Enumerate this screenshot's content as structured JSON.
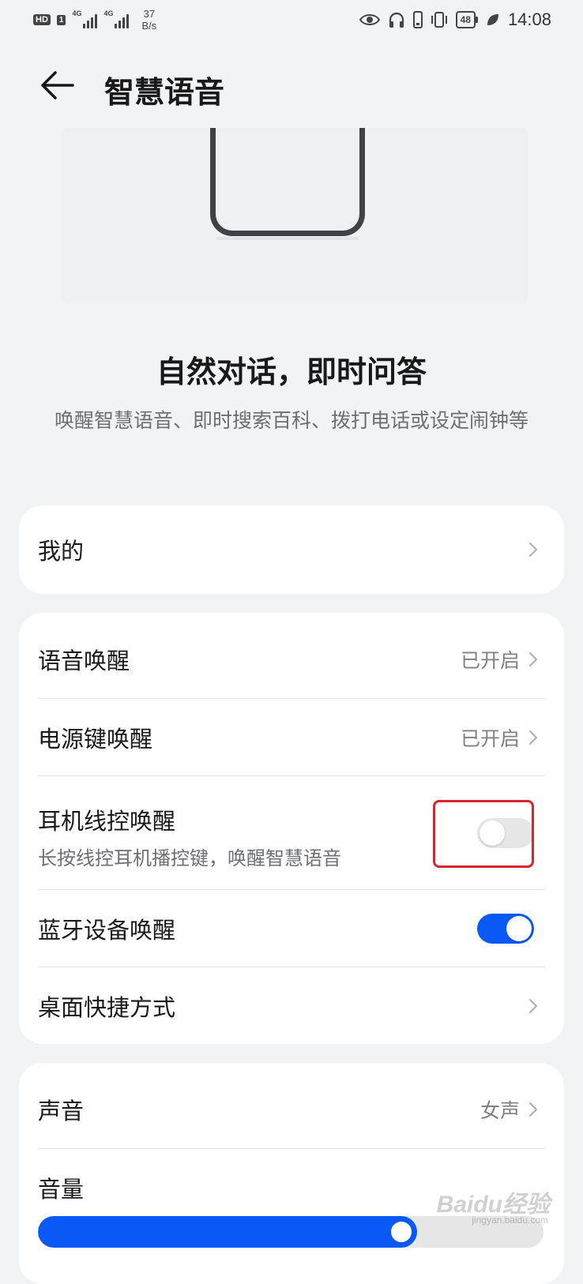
{
  "status_bar": {
    "hd": "HD",
    "sim": "1",
    "net1": "4G",
    "net2": "4G",
    "speed_value": "37",
    "speed_unit": "B/s",
    "battery": "48",
    "time": "14:08"
  },
  "header": {
    "title": "智慧语音"
  },
  "hero": {
    "headline": "自然对话，即时问答",
    "subtitle": "唤醒智慧语音、即时搜索百科、拨打电话或设定闹钟等"
  },
  "card_mine": {
    "label": "我的"
  },
  "card_wakeup": {
    "voice_wake": {
      "label": "语音唤醒",
      "value": "已开启"
    },
    "power_wake": {
      "label": "电源键唤醒",
      "value": "已开启"
    },
    "wired_wake": {
      "label": "耳机线控唤醒",
      "desc": "长按线控耳机播控键，唤醒智慧语音",
      "enabled": false
    },
    "bt_wake": {
      "label": "蓝牙设备唤醒",
      "enabled": true
    },
    "shortcut": {
      "label": "桌面快捷方式"
    }
  },
  "card_sound": {
    "voice": {
      "label": "声音",
      "value": "女声"
    },
    "volume": {
      "label": "音量",
      "level_percent": 75
    }
  },
  "watermark": {
    "text": "Baidu经验",
    "sub": "jingyan.baidu.com"
  },
  "colors": {
    "accent": "#0a59f7",
    "highlight": "#d9252e",
    "background": "#f1f3f5"
  }
}
